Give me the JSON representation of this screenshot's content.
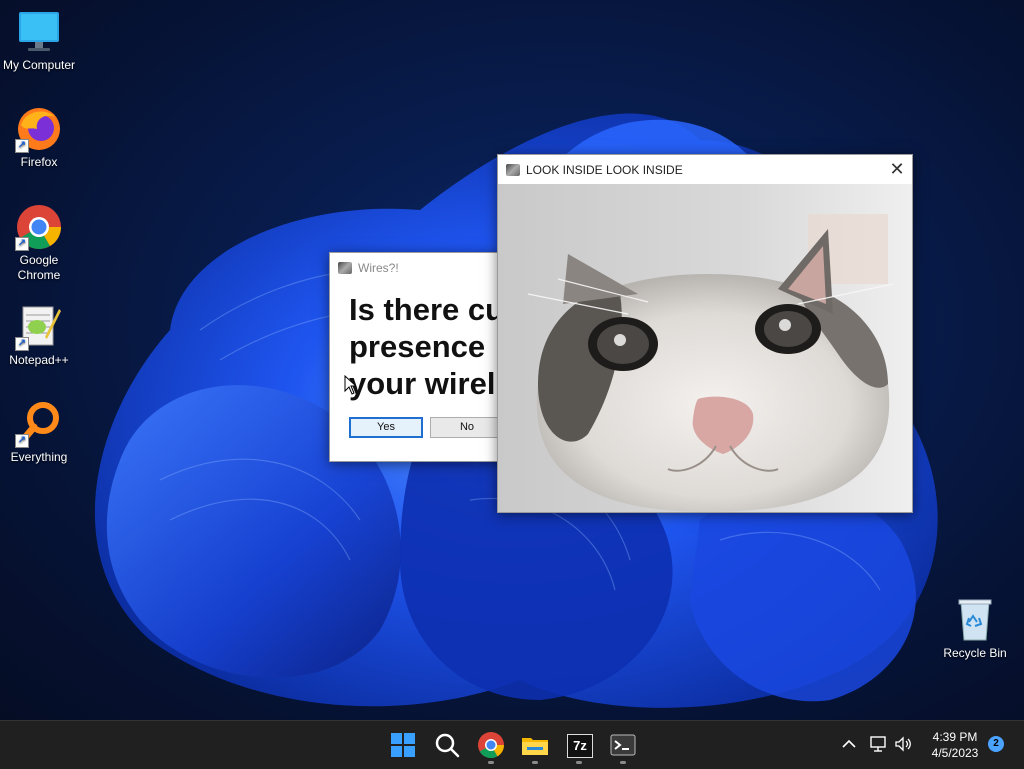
{
  "desktop": {
    "icons": [
      {
        "label": "My Computer"
      },
      {
        "label": "Firefox"
      },
      {
        "label": "Google Chrome"
      },
      {
        "label": "Notepad++"
      },
      {
        "label": "Everything"
      },
      {
        "label": "Recycle Bin"
      }
    ]
  },
  "dialog": {
    "title": "Wires?!",
    "line1": "Is there cu",
    "line2": "presence ",
    "line3": "your wirel",
    "yes_label": "Yes",
    "no_label": "No"
  },
  "cat_window": {
    "title": "LOOK INSIDE LOOK INSIDE",
    "close_label": "✕"
  },
  "taskbar": {
    "apps": [
      "start-icon",
      "search-icon",
      "chrome-icon",
      "file-explorer-icon",
      "7zip-icon",
      "terminal-icon"
    ],
    "sevenzip_text": "7z",
    "clock_time": "4:39 PM",
    "clock_date": "4/5/2023",
    "notification_count": "2",
    "tray_chevron": "^"
  },
  "colors": {
    "accent": "#1f6fd1",
    "wallpaper_blue": "#1a4fe0",
    "taskbar": "#202020"
  }
}
